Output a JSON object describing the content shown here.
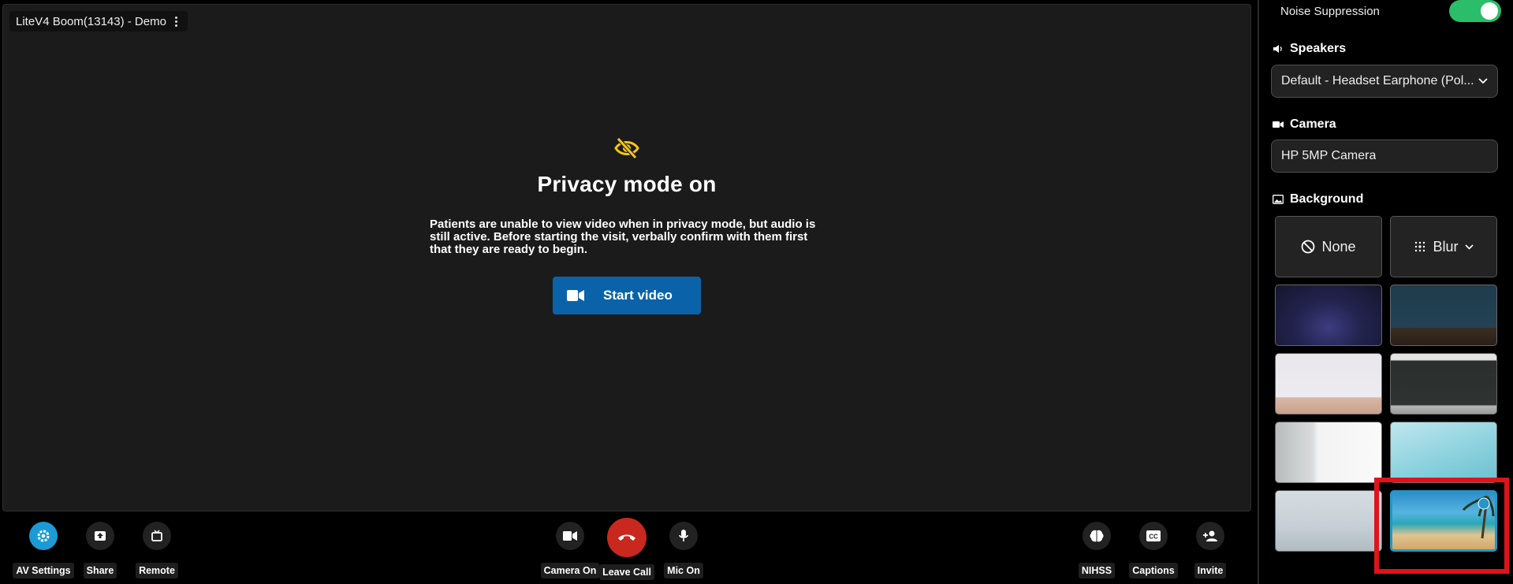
{
  "room": {
    "title": "LiteV4 Boom(13143) - Demo"
  },
  "privacy": {
    "title": "Privacy mode on",
    "text": "Patients are unable to view video when in privacy mode, but audio is still active. Before starting the visit, verbally confirm with them first that they are ready to begin.",
    "button": "Start video",
    "icon_color": "#f5c518"
  },
  "toolbar": {
    "av_settings": "AV Settings",
    "share": "Share",
    "remote": "Remote",
    "camera": "Camera On",
    "leave": "Leave Call",
    "mic": "Mic On",
    "nihss": "NIHSS",
    "captions": "Captions",
    "invite": "Invite"
  },
  "panel": {
    "noise_suppression": {
      "label": "Noise Suppression",
      "enabled": true
    },
    "speakers": {
      "label": "Speakers",
      "value": "Default - Headset Earphone (Pol..."
    },
    "camera": {
      "label": "Camera",
      "value": "HP 5MP Camera"
    },
    "background": {
      "label": "Background",
      "none": "None",
      "blur": "Blur",
      "images": [
        "purple-gradient",
        "teal-wall",
        "white-room",
        "dark-wall",
        "office",
        "light-blue",
        "grey-gradient",
        "beach-palm"
      ],
      "selected": "beach-palm"
    }
  },
  "colors": {
    "accent_blue": "#0a63a8",
    "settings_blue": "#1b9ad6",
    "leave_red": "#c8281e",
    "toggle_green": "#2bbd6a",
    "highlight_red": "#e0131a"
  }
}
